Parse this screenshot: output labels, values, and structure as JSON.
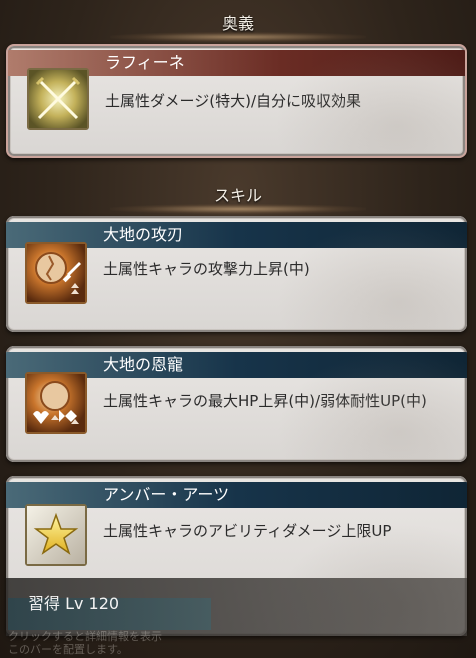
{
  "sections": {
    "ougi_label": "奥義",
    "skill_label": "スキル"
  },
  "ougi": {
    "name": "ラフィーネ",
    "description": "土属性ダメージ(特大)/自分に吸収効果",
    "icon": "crossed-swords-icon"
  },
  "skills": [
    {
      "name": "大地の攻刃",
      "description": "土属性キャラの攻撃力上昇(中)",
      "icon": "earth-attack-icon"
    },
    {
      "name": "大地の恩寵",
      "description": "土属性キャラの最大HP上昇(中)/弱体耐性UP(中)",
      "icon": "earth-hp-debuff-icon"
    },
    {
      "name": "アンバー・アーツ",
      "description": "土属性キャラのアビリティダメージ上限UP",
      "icon": "star-icon"
    }
  ],
  "footer": {
    "learn_text": "習得 Lv 120",
    "hint_line1": "クリックすると詳細情報を表示",
    "hint_line2": "このバーを配置します。"
  },
  "colors": {
    "ougi_title": "#6a2c24",
    "skill_title": "#17344a",
    "card_bg": "#e6e3e0"
  }
}
